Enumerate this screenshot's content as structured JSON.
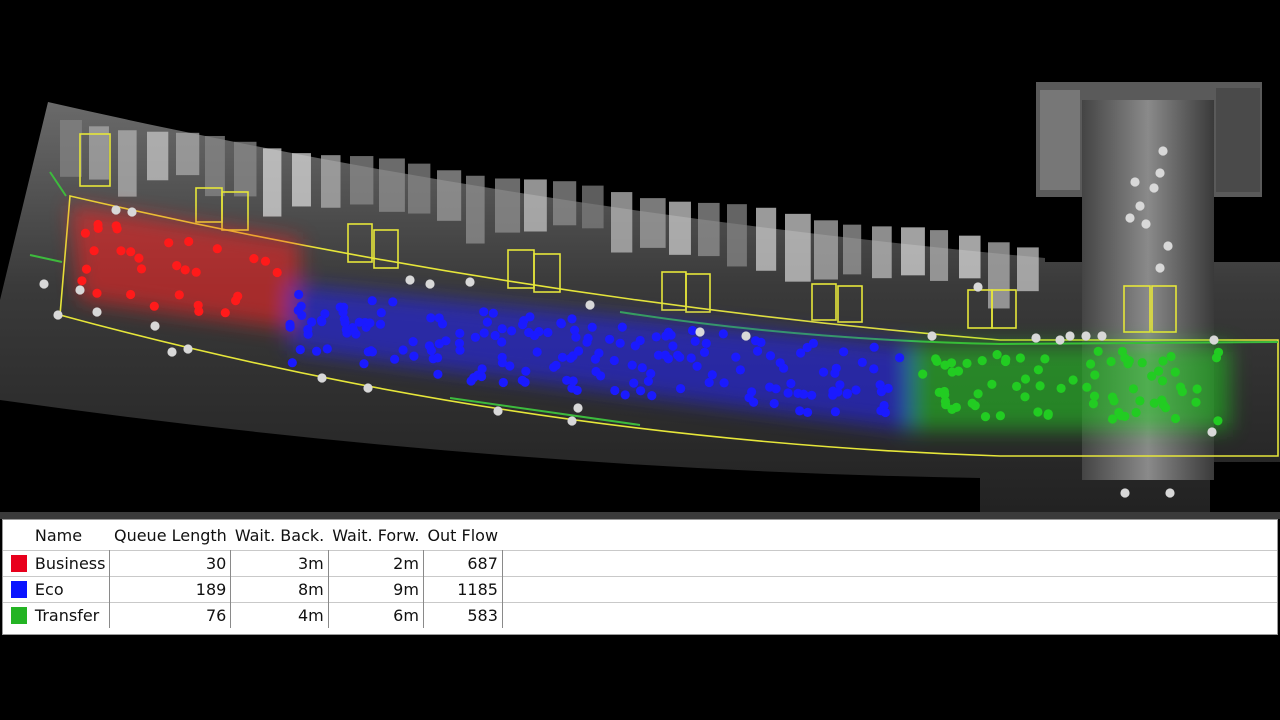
{
  "scene": {
    "name": "terminal-queue-simulation-view",
    "colors": {
      "business": "#ff1a1a",
      "eco": "#1a1aff",
      "transfer": "#22cc22",
      "passenger_idle": "#d8d8d8",
      "queue_outline": "#e6e63a"
    }
  },
  "table": {
    "headers": {
      "name": "Name",
      "queue_length": "Queue Length",
      "wait_back": "Wait. Back.",
      "wait_forw": "Wait. Forw.",
      "out_flow": "Out Flow"
    },
    "rows": [
      {
        "name": "Business",
        "color": "#e8001c",
        "queue_length": "30",
        "wait_back": "3m",
        "wait_forw": "2m",
        "out_flow": "687"
      },
      {
        "name": "Eco",
        "color": "#0a14ff",
        "queue_length": "189",
        "wait_back": "8m",
        "wait_forw": "9m",
        "out_flow": "1185"
      },
      {
        "name": "Transfer",
        "color": "#24b424",
        "queue_length": "76",
        "wait_back": "4m",
        "wait_forw": "6m",
        "out_flow": "583"
      }
    ]
  }
}
